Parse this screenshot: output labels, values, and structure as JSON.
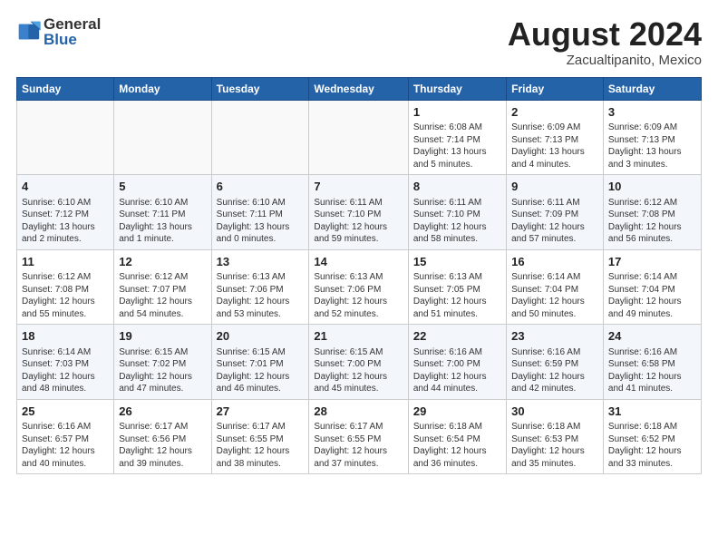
{
  "header": {
    "logo_general": "General",
    "logo_blue": "Blue",
    "month_year": "August 2024",
    "location": "Zacualtipanito, Mexico"
  },
  "days_of_week": [
    "Sunday",
    "Monday",
    "Tuesday",
    "Wednesday",
    "Thursday",
    "Friday",
    "Saturday"
  ],
  "weeks": [
    [
      {
        "day": "",
        "info": ""
      },
      {
        "day": "",
        "info": ""
      },
      {
        "day": "",
        "info": ""
      },
      {
        "day": "",
        "info": ""
      },
      {
        "day": "1",
        "info": "Sunrise: 6:08 AM\nSunset: 7:14 PM\nDaylight: 13 hours\nand 5 minutes."
      },
      {
        "day": "2",
        "info": "Sunrise: 6:09 AM\nSunset: 7:13 PM\nDaylight: 13 hours\nand 4 minutes."
      },
      {
        "day": "3",
        "info": "Sunrise: 6:09 AM\nSunset: 7:13 PM\nDaylight: 13 hours\nand 3 minutes."
      }
    ],
    [
      {
        "day": "4",
        "info": "Sunrise: 6:10 AM\nSunset: 7:12 PM\nDaylight: 13 hours\nand 2 minutes."
      },
      {
        "day": "5",
        "info": "Sunrise: 6:10 AM\nSunset: 7:11 PM\nDaylight: 13 hours\nand 1 minute."
      },
      {
        "day": "6",
        "info": "Sunrise: 6:10 AM\nSunset: 7:11 PM\nDaylight: 13 hours\nand 0 minutes."
      },
      {
        "day": "7",
        "info": "Sunrise: 6:11 AM\nSunset: 7:10 PM\nDaylight: 12 hours\nand 59 minutes."
      },
      {
        "day": "8",
        "info": "Sunrise: 6:11 AM\nSunset: 7:10 PM\nDaylight: 12 hours\nand 58 minutes."
      },
      {
        "day": "9",
        "info": "Sunrise: 6:11 AM\nSunset: 7:09 PM\nDaylight: 12 hours\nand 57 minutes."
      },
      {
        "day": "10",
        "info": "Sunrise: 6:12 AM\nSunset: 7:08 PM\nDaylight: 12 hours\nand 56 minutes."
      }
    ],
    [
      {
        "day": "11",
        "info": "Sunrise: 6:12 AM\nSunset: 7:08 PM\nDaylight: 12 hours\nand 55 minutes."
      },
      {
        "day": "12",
        "info": "Sunrise: 6:12 AM\nSunset: 7:07 PM\nDaylight: 12 hours\nand 54 minutes."
      },
      {
        "day": "13",
        "info": "Sunrise: 6:13 AM\nSunset: 7:06 PM\nDaylight: 12 hours\nand 53 minutes."
      },
      {
        "day": "14",
        "info": "Sunrise: 6:13 AM\nSunset: 7:06 PM\nDaylight: 12 hours\nand 52 minutes."
      },
      {
        "day": "15",
        "info": "Sunrise: 6:13 AM\nSunset: 7:05 PM\nDaylight: 12 hours\nand 51 minutes."
      },
      {
        "day": "16",
        "info": "Sunrise: 6:14 AM\nSunset: 7:04 PM\nDaylight: 12 hours\nand 50 minutes."
      },
      {
        "day": "17",
        "info": "Sunrise: 6:14 AM\nSunset: 7:04 PM\nDaylight: 12 hours\nand 49 minutes."
      }
    ],
    [
      {
        "day": "18",
        "info": "Sunrise: 6:14 AM\nSunset: 7:03 PM\nDaylight: 12 hours\nand 48 minutes."
      },
      {
        "day": "19",
        "info": "Sunrise: 6:15 AM\nSunset: 7:02 PM\nDaylight: 12 hours\nand 47 minutes."
      },
      {
        "day": "20",
        "info": "Sunrise: 6:15 AM\nSunset: 7:01 PM\nDaylight: 12 hours\nand 46 minutes."
      },
      {
        "day": "21",
        "info": "Sunrise: 6:15 AM\nSunset: 7:00 PM\nDaylight: 12 hours\nand 45 minutes."
      },
      {
        "day": "22",
        "info": "Sunrise: 6:16 AM\nSunset: 7:00 PM\nDaylight: 12 hours\nand 44 minutes."
      },
      {
        "day": "23",
        "info": "Sunrise: 6:16 AM\nSunset: 6:59 PM\nDaylight: 12 hours\nand 42 minutes."
      },
      {
        "day": "24",
        "info": "Sunrise: 6:16 AM\nSunset: 6:58 PM\nDaylight: 12 hours\nand 41 minutes."
      }
    ],
    [
      {
        "day": "25",
        "info": "Sunrise: 6:16 AM\nSunset: 6:57 PM\nDaylight: 12 hours\nand 40 minutes."
      },
      {
        "day": "26",
        "info": "Sunrise: 6:17 AM\nSunset: 6:56 PM\nDaylight: 12 hours\nand 39 minutes."
      },
      {
        "day": "27",
        "info": "Sunrise: 6:17 AM\nSunset: 6:55 PM\nDaylight: 12 hours\nand 38 minutes."
      },
      {
        "day": "28",
        "info": "Sunrise: 6:17 AM\nSunset: 6:55 PM\nDaylight: 12 hours\nand 37 minutes."
      },
      {
        "day": "29",
        "info": "Sunrise: 6:18 AM\nSunset: 6:54 PM\nDaylight: 12 hours\nand 36 minutes."
      },
      {
        "day": "30",
        "info": "Sunrise: 6:18 AM\nSunset: 6:53 PM\nDaylight: 12 hours\nand 35 minutes."
      },
      {
        "day": "31",
        "info": "Sunrise: 6:18 AM\nSunset: 6:52 PM\nDaylight: 12 hours\nand 33 minutes."
      }
    ]
  ]
}
